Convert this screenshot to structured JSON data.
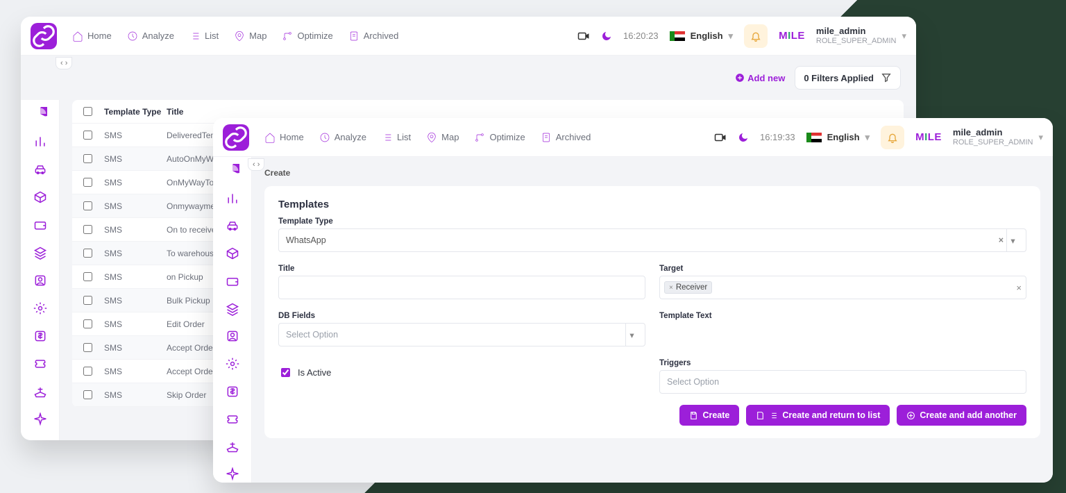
{
  "nav": {
    "home": "Home",
    "analyze": "Analyze",
    "list": "List",
    "map": "Map",
    "optimize": "Optimize",
    "archived": "Archived"
  },
  "back": {
    "time": "16:20:23",
    "language": "English",
    "user_name": "mile_admin",
    "user_role": "ROLE_SUPER_ADMIN",
    "add_new": "Add new",
    "filters": "0 Filters Applied",
    "table": {
      "headers": {
        "type": "Template Type",
        "title": "Title"
      },
      "rows": [
        {
          "type": "SMS",
          "title": "DeliveredTempla"
        },
        {
          "type": "SMS",
          "title": "AutoOnMyWay"
        },
        {
          "type": "SMS",
          "title": "OnMyWayToPick"
        },
        {
          "type": "SMS",
          "title": "Onmywaymerch"
        },
        {
          "type": "SMS",
          "title": "On to receiver"
        },
        {
          "type": "SMS",
          "title": "To warehouse"
        },
        {
          "type": "SMS",
          "title": "on Pickup"
        },
        {
          "type": "SMS",
          "title": "Bulk Pickup"
        },
        {
          "type": "SMS",
          "title": "Edit Order"
        },
        {
          "type": "SMS",
          "title": "Accept Order"
        },
        {
          "type": "SMS",
          "title": "Accept Order"
        },
        {
          "type": "SMS",
          "title": "Skip Order"
        }
      ]
    }
  },
  "front": {
    "time": "16:19:33",
    "language": "English",
    "user_name": "mile_admin",
    "user_role": "ROLE_SUPER_ADMIN",
    "breadcrumb": "Create",
    "form": {
      "heading": "Templates",
      "labels": {
        "template_type": "Template Type",
        "title": "Title",
        "target": "Target",
        "db_fields": "DB Fields",
        "template_text": "Template Text",
        "triggers": "Triggers",
        "is_active": "Is Active"
      },
      "values": {
        "template_type": "WhatsApp",
        "target_tag": "Receiver",
        "db_fields_placeholder": "Select Option",
        "triggers_placeholder": "Select Option",
        "is_active_checked": true
      },
      "buttons": {
        "create": "Create",
        "create_return": "Create and return to list",
        "create_another": "Create and add another"
      }
    }
  },
  "brand": "MILE"
}
